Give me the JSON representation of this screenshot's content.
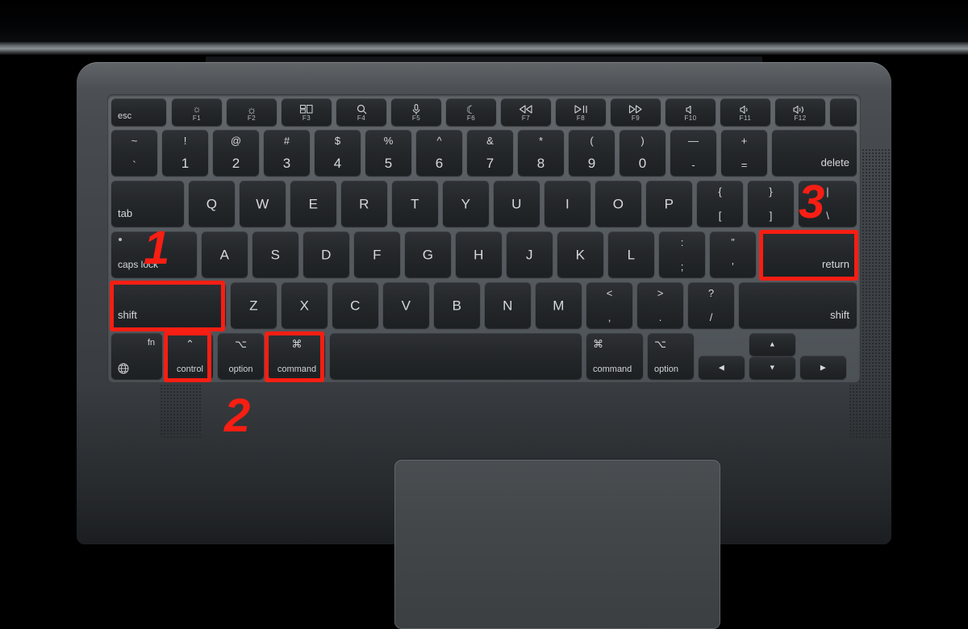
{
  "scene": {
    "device": "MacBook keyboard",
    "background_color": "#000000",
    "body_color": "#474b4f",
    "key_color": "#25282b",
    "annotation_color": "#f81e13"
  },
  "keyboard": {
    "function_row": [
      {
        "label": "esc",
        "icon": "",
        "fn": "",
        "type": "esc"
      },
      {
        "label": "",
        "icon": "brightness-low-icon",
        "glyph": "☼",
        "fn": "F1"
      },
      {
        "label": "",
        "icon": "brightness-high-icon",
        "glyph": "☀",
        "fn": "F2"
      },
      {
        "label": "",
        "icon": "mission-control-icon",
        "glyph": "☷",
        "fn": "F3"
      },
      {
        "label": "",
        "icon": "spotlight-search-icon",
        "glyph": "⌕",
        "fn": "F4"
      },
      {
        "label": "",
        "icon": "dictation-microphone-icon",
        "glyph": "Ἲ4",
        "fn": "F5"
      },
      {
        "label": "",
        "icon": "do-not-disturb-moon-icon",
        "glyph": "☾",
        "fn": "F6"
      },
      {
        "label": "",
        "icon": "rewind-icon",
        "glyph": "◁◁",
        "fn": "F7"
      },
      {
        "label": "",
        "icon": "play-pause-icon",
        "glyph": "▷‖",
        "fn": "F8"
      },
      {
        "label": "",
        "icon": "fast-forward-icon",
        "glyph": "▷▷",
        "fn": "F9"
      },
      {
        "label": "",
        "icon": "volume-mute-icon",
        "glyph": "◁",
        "fn": "F10"
      },
      {
        "label": "",
        "icon": "volume-down-icon",
        "glyph": "◁)",
        "fn": "F11"
      },
      {
        "label": "",
        "icon": "volume-up-icon",
        "glyph": "◁))",
        "fn": "F12"
      },
      {
        "label": "",
        "icon": "touch-id-power-icon",
        "glyph": "",
        "fn": ""
      }
    ],
    "number_row": [
      {
        "top": "~",
        "bottom": "`"
      },
      {
        "top": "!",
        "bottom": "1"
      },
      {
        "top": "@",
        "bottom": "2"
      },
      {
        "top": "#",
        "bottom": "3"
      },
      {
        "top": "$",
        "bottom": "4"
      },
      {
        "top": "%",
        "bottom": "5"
      },
      {
        "top": "^",
        "bottom": "6"
      },
      {
        "top": "&",
        "bottom": "7"
      },
      {
        "top": "*",
        "bottom": "8"
      },
      {
        "top": "(",
        "bottom": "9"
      },
      {
        "top": ")",
        "bottom": "0"
      },
      {
        "top": "—",
        "bottom": "-"
      },
      {
        "top": "+",
        "bottom": "="
      },
      {
        "label": "delete"
      }
    ],
    "qwerty_row": [
      {
        "label": "tab"
      },
      {
        "label": "Q"
      },
      {
        "label": "W"
      },
      {
        "label": "E"
      },
      {
        "label": "R"
      },
      {
        "label": "T"
      },
      {
        "label": "Y"
      },
      {
        "label": "U"
      },
      {
        "label": "I"
      },
      {
        "label": "O"
      },
      {
        "label": "P"
      },
      {
        "top": "{",
        "bottom": "["
      },
      {
        "top": "}",
        "bottom": "]"
      },
      {
        "top": "|",
        "bottom": "\\"
      }
    ],
    "home_row": [
      {
        "label": "caps lock"
      },
      {
        "label": "A"
      },
      {
        "label": "S"
      },
      {
        "label": "D"
      },
      {
        "label": "F"
      },
      {
        "label": "G"
      },
      {
        "label": "H"
      },
      {
        "label": "J"
      },
      {
        "label": "K"
      },
      {
        "label": "L"
      },
      {
        "top": ":",
        "bottom": ";"
      },
      {
        "top": "”",
        "bottom": "’"
      },
      {
        "label": "return"
      }
    ],
    "shift_row": [
      {
        "label": "shift"
      },
      {
        "label": "Z"
      },
      {
        "label": "X"
      },
      {
        "label": "C"
      },
      {
        "label": "V"
      },
      {
        "label": "B"
      },
      {
        "label": "N"
      },
      {
        "label": "M"
      },
      {
        "top": "<",
        "bottom": ","
      },
      {
        "top": ">",
        "bottom": "."
      },
      {
        "top": "?",
        "bottom": "/"
      },
      {
        "label": "shift"
      }
    ],
    "bottom_row": [
      {
        "label": "fn",
        "symbol": "⊕",
        "icon": "globe-icon"
      },
      {
        "label": "control",
        "symbol": "⌃",
        "icon": "control-caret-icon"
      },
      {
        "label": "option",
        "symbol": "⌥",
        "icon": "option-alt-icon"
      },
      {
        "label": "command",
        "symbol": "⌘",
        "icon": "command-icon"
      },
      {
        "label": "",
        "icon": "space-bar"
      },
      {
        "label": "command",
        "symbol": "⌘",
        "icon": "command-icon"
      },
      {
        "label": "option",
        "symbol": "⌥",
        "icon": "option-alt-icon"
      },
      {
        "label": "◀",
        "icon": "arrow-left-icon"
      },
      {
        "label": "▲",
        "icon": "arrow-up-icon"
      },
      {
        "label": "▼",
        "icon": "arrow-down-icon"
      },
      {
        "label": "▶",
        "icon": "arrow-right-icon"
      }
    ]
  },
  "annotations": {
    "steps": [
      {
        "number": "1",
        "target": "shift-key-left",
        "description": "left shift key highlighted"
      },
      {
        "number": "2",
        "target": "control-and-command-keys",
        "description": "control and command keys highlighted"
      },
      {
        "number": "3",
        "target": "return-key",
        "description": "return key highlighted"
      }
    ],
    "labels": {
      "one": "1",
      "two": "2",
      "three": "3"
    }
  }
}
